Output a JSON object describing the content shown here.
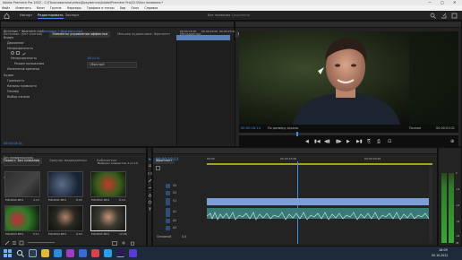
{
  "window": {
    "title": "Adobe Premiere Pro 2022 - C:\\Пользователи\\video\\Документы\\Adobe\\Premiere Pro\\22.0\\Без названия *",
    "controls": [
      "—",
      "□",
      "✕"
    ]
  },
  "menu": [
    "Файл",
    "Изменить",
    "Клип",
    "Группа",
    "Маркеры",
    "Графика и титры",
    "Вид",
    "Окно",
    "Справка"
  ],
  "workspace": {
    "tabs": [
      "Импорт",
      "Редактировать",
      "Экспорт"
    ],
    "active_tab": "Редактировать",
    "project_name": "Без названия",
    "saved_status": "- Сохранено"
  },
  "effects_panel": {
    "tabs": [
      "Источник: (нет клипов)",
      "Элементы управления эффектом",
      "Микшер аудиоклипа: Фрагмент",
      "Метаданные"
    ],
    "source": "Источник • Фрагмент.mp4",
    "sequence": "Фрагмент • Фрагмент.mp4",
    "sections": [
      "Видео",
      "Движение",
      "Непрозрачность",
      "Режим наложения",
      "Изменение времени",
      "Аудио",
      "Громкость",
      "Каналы громкости",
      "Паннер",
      "Выбор канала"
    ],
    "opacity_label": "Непрозрачность",
    "opacity_value": "100,0 %",
    "blend_label": "Режим наложения",
    "blend_value": "Обычный",
    "timecode": "00:00:16:14",
    "clip_label": "Фрагмент.mp4",
    "ruler": [
      "00:00:15:00",
      "00:00:20:00",
      "00:00:25:00"
    ]
  },
  "program_monitor": {
    "tab": "Программа: Фрагмент",
    "timecode": "00:00:16:14",
    "fit": "По размеру экрана",
    "quality": "Полное",
    "duration": "00:00:01:02",
    "controls": [
      "◀",
      "▮◀",
      "◀▮",
      "▶",
      "▮▶",
      "▶▮",
      "⎘",
      "⎙",
      "⊡",
      "⊕"
    ]
  },
  "project_panel": {
    "tabs": [
      "Проект: Без названия",
      "Браузер медиаданных",
      "Библиотеки",
      "Информация",
      "Эффекты"
    ],
    "path": "Без названия.prproj",
    "count": "Выбрано элементов: 1 из 10",
    "items": [
      {
        "name": "ЕЖ4890.MP4",
        "duration": "4:23"
      },
      {
        "name": "ЕЖ4891.MP4",
        "duration": "8:05"
      },
      {
        "name": "ЕЖ4892.MP4",
        "duration": "6:16"
      },
      {
        "name": "ЕЖ4893.MP4",
        "duration": "5:11"
      },
      {
        "name": "ЕЖ4894.MP4",
        "duration": "9:02"
      },
      {
        "name": "ЕЖ4895.MP4",
        "duration": "12:08"
      }
    ]
  },
  "timeline": {
    "tab": "Фрагмент",
    "timecode": "00:00:16:14",
    "ruler": [
      "00:00",
      "00:00:15:00",
      "00:00:30:00"
    ],
    "tracks": [
      "V3",
      "V2",
      "V1",
      "A1",
      "A2",
      "A3"
    ],
    "clip_name": "Фрагмент.mp4 [V]",
    "master": "Основной",
    "master_value": "0,0"
  },
  "audio_meter": {
    "scale": [
      "0",
      "-12",
      "-24",
      "-36",
      "-48",
      "dB"
    ]
  },
  "taskbar": {
    "clock": "16:09",
    "date": "05.10.2022"
  }
}
